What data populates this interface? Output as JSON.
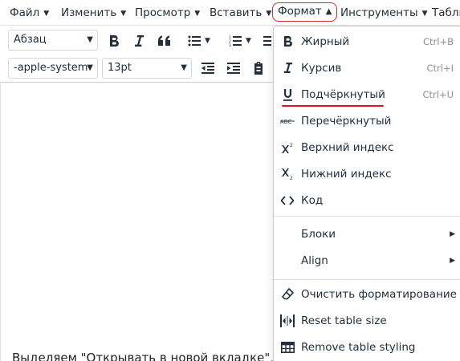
{
  "menubar": {
    "items": [
      {
        "label": "Файл"
      },
      {
        "label": "Изменить"
      },
      {
        "label": "Просмотр"
      },
      {
        "label": "Вставить"
      },
      {
        "label": "Формат"
      },
      {
        "label": "Инструменты"
      },
      {
        "label": "Табли"
      }
    ]
  },
  "toolbar": {
    "block_format": "Абзац",
    "font_family": "-apple-system",
    "font_size": "13pt"
  },
  "editor": {
    "text": "Выделяем \"Открывать в новой вкладке\", и"
  },
  "format_menu": {
    "items": [
      {
        "label": "Жирный",
        "shortcut": "Ctrl+B"
      },
      {
        "label": "Курсив",
        "shortcut": "Ctrl+I"
      },
      {
        "label": "Подчёркнутый",
        "shortcut": "Ctrl+U"
      },
      {
        "label": "Перечёркнутый"
      },
      {
        "label": "Верхний индекс"
      },
      {
        "label": "Нижний индекс"
      },
      {
        "label": "Код"
      },
      {
        "label": "Блоки"
      },
      {
        "label": "Align"
      },
      {
        "label": "Очистить форматирование"
      },
      {
        "label": "Reset table size"
      },
      {
        "label": "Remove table styling"
      }
    ]
  },
  "colors": {
    "highlight": "#d7262e",
    "underline_mark": "#e5131b",
    "text": "#222f3e",
    "shortcut": "#8a8f99"
  }
}
